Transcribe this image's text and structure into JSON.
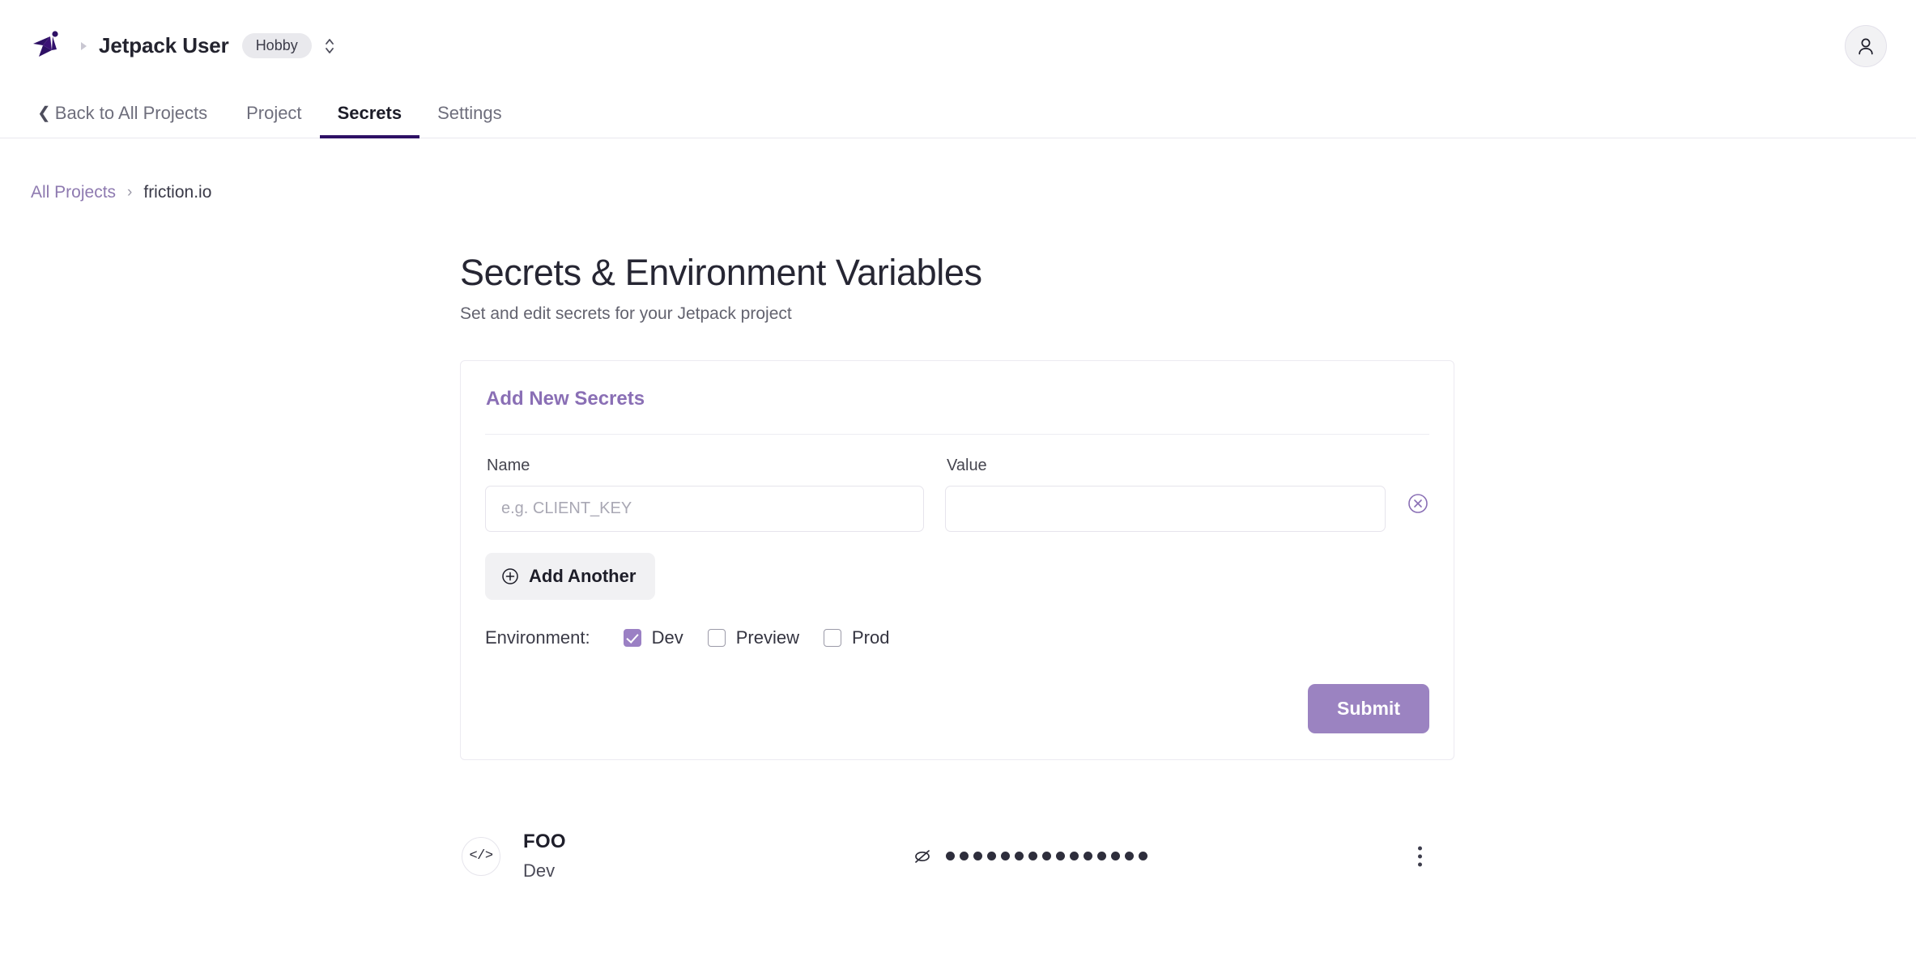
{
  "header": {
    "logo_icon": "jetpack-logo-icon",
    "separator_icon": "triangle-right-icon",
    "account_name": "Jetpack User",
    "plan_badge": "Hobby",
    "plan_switch_icon": "chevron-up-down-icon",
    "avatar_icon": "user-avatar-icon"
  },
  "nav": {
    "back_chevron": "❮",
    "back_label": "Back to All Projects",
    "tabs": [
      {
        "label": "Project",
        "active": false
      },
      {
        "label": "Secrets",
        "active": true
      },
      {
        "label": "Settings",
        "active": false
      }
    ],
    "active_underline_color": "#2e1065"
  },
  "breadcrumb": {
    "root": "All Projects",
    "separator": "›",
    "current": "friction.io",
    "link_color": "#8e7ab0"
  },
  "page": {
    "title": "Secrets & Environment Variables",
    "subtitle": "Set and edit secrets for your Jetpack project"
  },
  "card": {
    "title": "Add New Secrets",
    "title_color": "#8a6fb5",
    "name_field": {
      "label": "Name",
      "placeholder": "e.g. CLIENT_KEY",
      "value": ""
    },
    "value_field": {
      "label": "Value",
      "placeholder": "",
      "value": ""
    },
    "remove_icon": "circle-x-icon",
    "add_another": {
      "label": "Add Another",
      "icon": "plus-circle-icon"
    },
    "environment": {
      "label": "Environment:",
      "options": [
        {
          "label": "Dev",
          "checked": true
        },
        {
          "label": "Preview",
          "checked": false
        },
        {
          "label": "Prod",
          "checked": false
        }
      ],
      "checked_color": "#9b80c4"
    },
    "submit": {
      "label": "Submit",
      "color": "#9b83c1"
    }
  },
  "secrets": [
    {
      "icon": "code-brackets-icon",
      "icon_glyph": "</>",
      "name": "FOO",
      "environment": "Dev",
      "visibility_icon": "eye-off-icon",
      "masked_value": "●●●●●●●●●●●●●●●",
      "masked_dot_count": 15,
      "menu_icon": "kebab-menu-icon"
    }
  ]
}
